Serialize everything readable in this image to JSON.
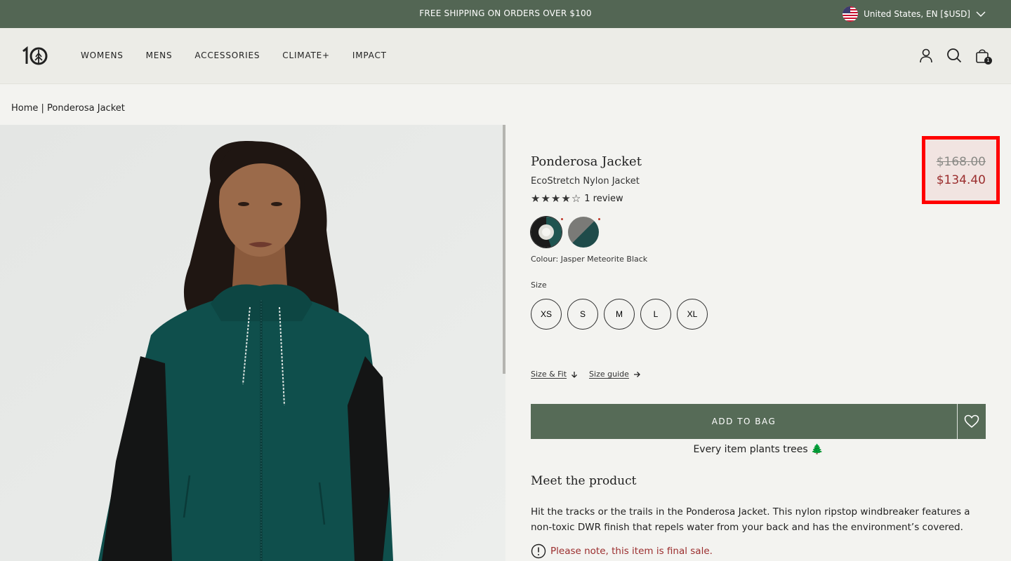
{
  "announcement": {
    "message": "FREE SHIPPING ON ORDERS OVER $100",
    "locale": "United States, EN [$USD]"
  },
  "header": {
    "logo_text": "10",
    "nav": [
      "WOMENS",
      "MENS",
      "ACCESSORIES",
      "CLIMATE+",
      "IMPACT"
    ],
    "bag_count": "1"
  },
  "breadcrumb": {
    "home": "Home",
    "separator": " | ",
    "current": "Ponderosa Jacket"
  },
  "product": {
    "title": "Ponderosa Jacket",
    "subtitle": "EcoStretch Nylon Jacket",
    "rating": 4,
    "rating_max": 5,
    "review_text": "1 review",
    "price_was": "$168.00",
    "price_now": "$134.40",
    "colour_label": "Colour: Jasper Meteorite Black",
    "size_label": "Size",
    "sizes": [
      "XS",
      "S",
      "M",
      "L",
      "XL"
    ],
    "size_fit_link": "Size & Fit",
    "size_guide_link": "Size guide",
    "add_to_bag": "ADD TO BAG",
    "trees_note": "Every item plants trees 🌲",
    "meet_heading": "Meet the product",
    "description": "Hit the tracks or the trails in the Ponderosa Jacket. This nylon ripstop windbreaker features a non-toxic DWR finish that repels water from your back and has the environment’s covered.",
    "final_sale": "Please note, this item is final sale."
  },
  "colors": {
    "brand_green": "#536654",
    "sale_red": "#9b2e2e",
    "highlight_border": "#ff0000",
    "jacket_teal": "#0f4f4c"
  }
}
